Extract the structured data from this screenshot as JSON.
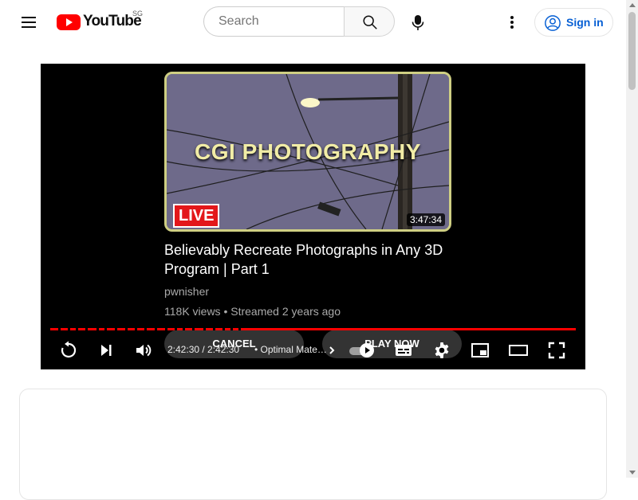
{
  "masthead": {
    "logo_text": "YouTube",
    "country_code": "SG",
    "search_placeholder": "Search",
    "signin_label": "Sign in",
    "icons": [
      "menu-icon",
      "youtube-logo-icon",
      "search-icon",
      "mic-icon",
      "more-vert-icon",
      "account-icon"
    ]
  },
  "player": {
    "up_next": {
      "thumbnail_text": "CGI PHOTOGRAPHY",
      "live_badge": "LIVE",
      "duration": "3:47:34",
      "title": "Believably Recreate Photographs in Any 3D Program | Part 1",
      "channel": "pwnisher",
      "meta": "118K views • Streamed 2 years ago",
      "cancel_label": "CANCEL",
      "play_now_label": "PLAY NOW"
    },
    "progress_percent": 100,
    "controls": {
      "time": "2:42:30 / 2:42:30",
      "chapter": "• Optimal Mate…",
      "autoplay_on": true,
      "icons": [
        "replay-icon",
        "next-icon",
        "volume-icon",
        "chapter-chevron-icon",
        "autoplay-toggle-icon",
        "subtitles-icon",
        "settings-icon",
        "miniplayer-icon",
        "theater-mode-icon",
        "fullscreen-icon"
      ]
    }
  },
  "colors": {
    "accent": "#ff0000",
    "signin_blue": "#065fd4",
    "player_bg": "#000000"
  }
}
